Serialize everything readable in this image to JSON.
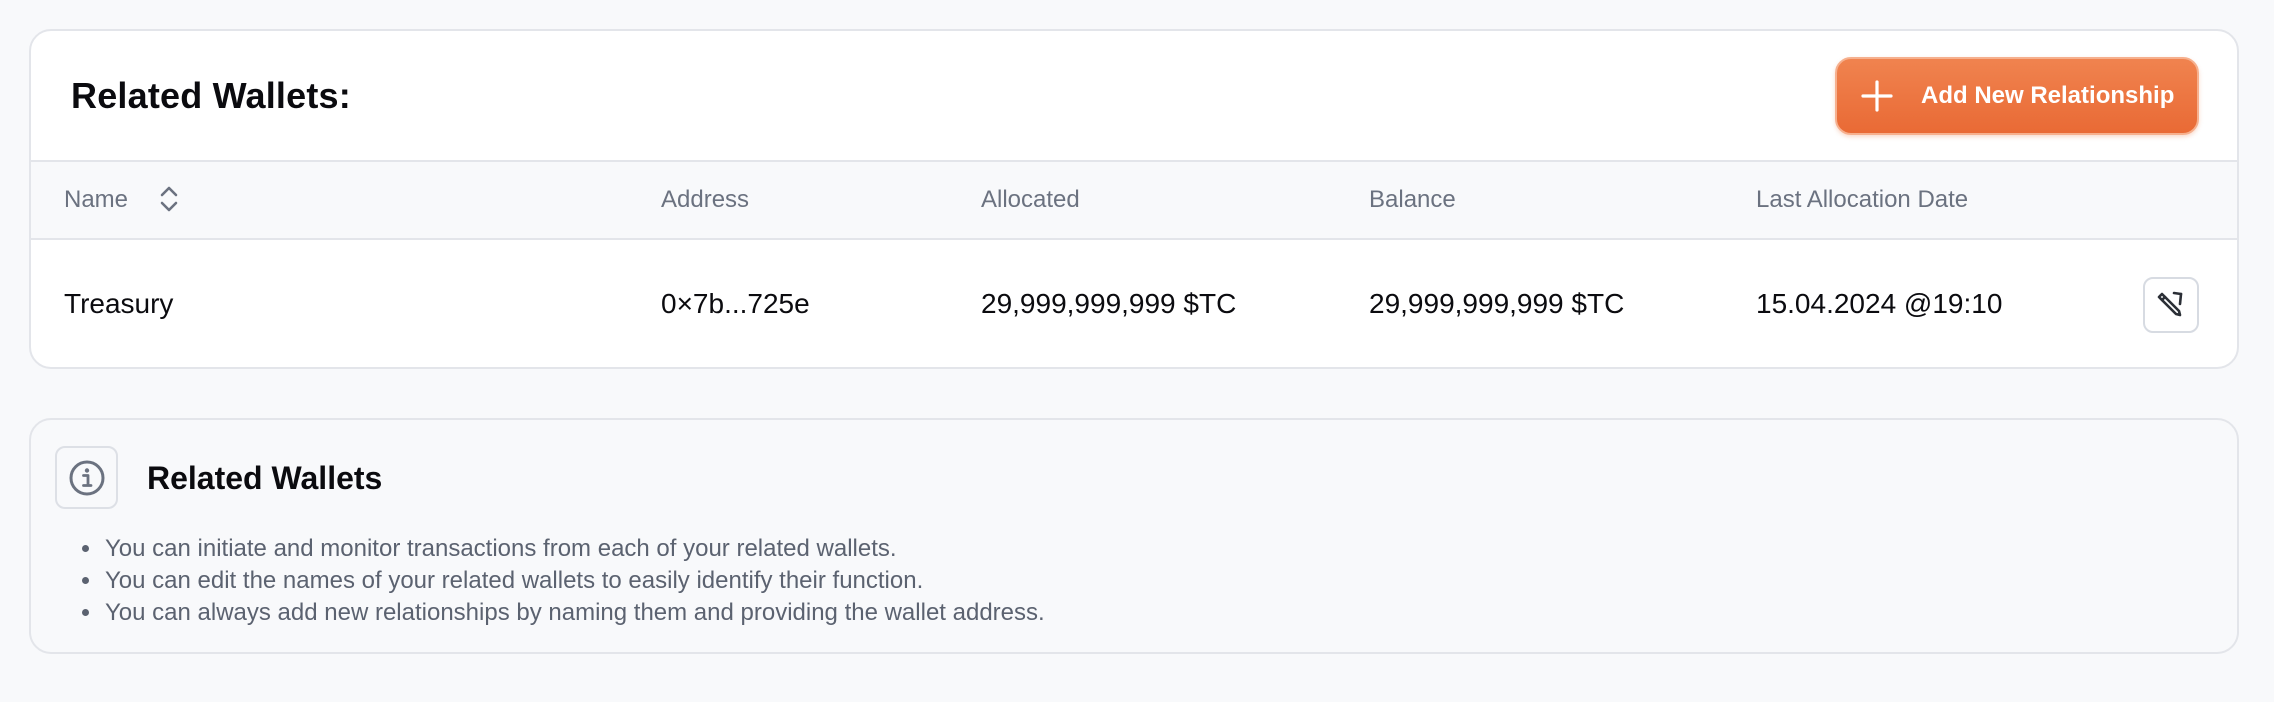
{
  "card": {
    "title": "Related Wallets:",
    "add_button_label": "Add New Relationship"
  },
  "table": {
    "headers": {
      "name": "Name",
      "address": "Address",
      "allocated": "Allocated",
      "balance": "Balance",
      "last_allocation_date": "Last Allocation Date"
    },
    "rows": [
      {
        "name": "Treasury",
        "address": "0×7b...725e",
        "allocated": "29,999,999,999 $TC",
        "balance": "29,999,999,999 $TC",
        "last_allocation_date": "15.04.2024 @19:10"
      }
    ]
  },
  "info": {
    "title": "Related Wallets",
    "items": [
      "You can initiate and monitor transactions from each of your related wallets.",
      "You can edit the names of your related wallets to easily identify their function.",
      "You can always add new relationships by naming them and providing the wallet address."
    ]
  },
  "colors": {
    "accent": "#EE7A45",
    "border": "#E3E5EA",
    "muted_text": "#6B7280"
  },
  "icons": {
    "add": "plus-icon",
    "sort": "sort-icon",
    "edit": "edit-pencil-icon",
    "info": "info-icon"
  }
}
